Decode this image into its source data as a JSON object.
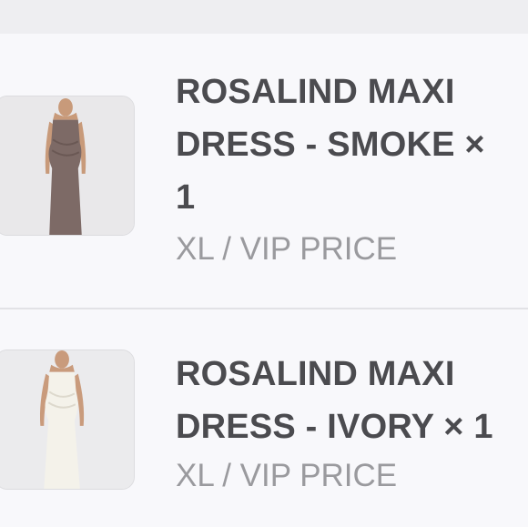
{
  "cart": {
    "items": [
      {
        "title": "ROSALIND MAXI DRESS - SMOKE × 1",
        "variant": "XL / VIP PRICE",
        "thumbnail_icon": "dress-smoke-thumbnail",
        "dress_color": "#7d6a66"
      },
      {
        "title": "ROSALIND MAXI DRESS - IVORY × 1",
        "variant": "XL / VIP PRICE",
        "thumbnail_icon": "dress-ivory-thumbnail",
        "dress_color": "#f3f1e8"
      }
    ]
  }
}
